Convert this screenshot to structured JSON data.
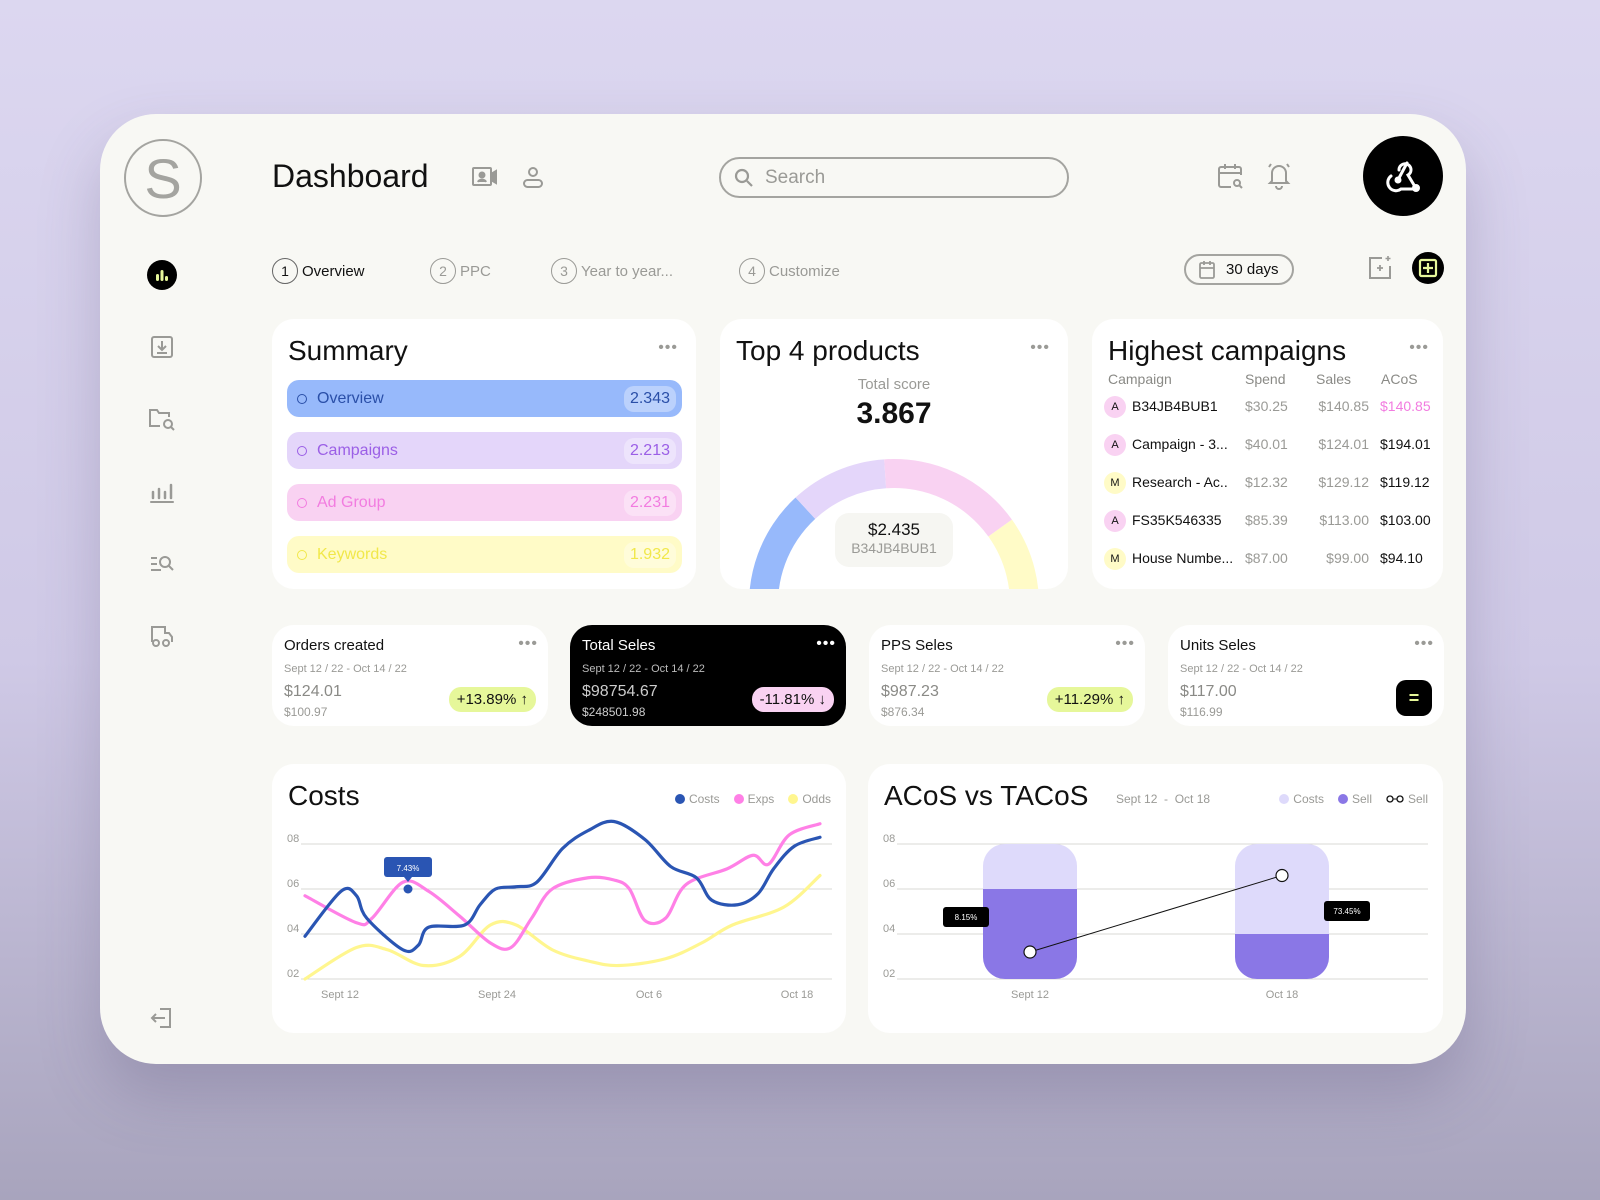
{
  "header": {
    "logo_letter": "S",
    "title": "Dashboard",
    "search_placeholder": "Search"
  },
  "tabs": [
    {
      "num": "1",
      "label": "Overview",
      "active": true
    },
    {
      "num": "2",
      "label": "PPC",
      "active": false
    },
    {
      "num": "3",
      "label": "Year to year...",
      "active": false
    },
    {
      "num": "4",
      "label": "Customize",
      "active": false
    }
  ],
  "date_range_button": "30 days",
  "summary": {
    "title": "Summary",
    "rows": [
      {
        "label": "Overview",
        "value": "2.343"
      },
      {
        "label": "Campaigns",
        "value": "2.213"
      },
      {
        "label": "Ad Group",
        "value": "2.231"
      },
      {
        "label": "Keywords",
        "value": "1.932"
      }
    ]
  },
  "top_products": {
    "title": "Top 4 products",
    "score_label": "Total score",
    "score_value": "3.867",
    "center_value": "$2.435",
    "center_label": "B34JB4BUB1",
    "segments": [
      {
        "share": 0.28,
        "color": "#97b9fb"
      },
      {
        "share": 0.2,
        "color": "#e4d6fa"
      },
      {
        "share": 0.3,
        "color": "#f9d2f2"
      },
      {
        "share": 0.22,
        "color": "#fffbc7"
      }
    ]
  },
  "campaigns": {
    "title": "Highest campaigns",
    "columns": [
      "Campaign",
      "Spend",
      "Sales",
      "ACoS"
    ],
    "rows": [
      {
        "badge": "A",
        "name": "B34JB4BUB1",
        "spend": "$30.25",
        "sales": "$140.85",
        "acos": "$140.85",
        "highlight": true
      },
      {
        "badge": "A",
        "name": "Campaign - 3...",
        "spend": "$40.01",
        "sales": "$124.01",
        "acos": "$194.01",
        "highlight": false
      },
      {
        "badge": "M",
        "name": "Research - Ac..",
        "spend": "$12.32",
        "sales": "$129.12",
        "acos": "$119.12",
        "highlight": false
      },
      {
        "badge": "A",
        "name": "FS35K546335",
        "spend": "$85.39",
        "sales": "$113.00",
        "acos": "$103.00",
        "highlight": false
      },
      {
        "badge": "M",
        "name": "House Numbe...",
        "spend": "$87.00",
        "sales": "$99.00",
        "acos": "$94.10",
        "highlight": false
      }
    ]
  },
  "stats": [
    {
      "title": "Orders created",
      "date": "Sept 12 / 22 - Oct 14 / 22",
      "value": "$124.01",
      "prev": "$100.97",
      "change": "+13.89% ↑"
    },
    {
      "title": "Total Seles",
      "date": "Sept 12 / 22 - Oct 14 / 22",
      "value": "$98754.67",
      "prev": "$248501.98",
      "change": "-11.81% ↓"
    },
    {
      "title": "PPS Seles",
      "date": "Sept 12 / 22 - Oct 14 / 22",
      "value": "$987.23",
      "prev": "$876.34",
      "change": "+11.29% ↑"
    },
    {
      "title": "Units Seles",
      "date": "Sept 12 / 22 - Oct 14 / 22",
      "value": "$117.00",
      "prev": "$116.99",
      "change": "="
    }
  ],
  "chart_data": [
    {
      "type": "line",
      "title": "Costs",
      "x": [
        "Sept 12",
        "Sept 24",
        "Oct 6",
        "Oct 18"
      ],
      "xlim": [
        0,
        1
      ],
      "ylim": [
        2,
        9
      ],
      "yticks": [
        "02",
        "04",
        "06",
        "08"
      ],
      "grid": true,
      "legend": "top-right",
      "tooltip": {
        "series": "Costs",
        "x": 0.2,
        "y": 6.0,
        "label": "7.43%"
      },
      "series": [
        {
          "name": "Costs",
          "color": "#2a55b3",
          "points": [
            [
              0,
              3.9
            ],
            [
              0.07,
              5.9
            ],
            [
              0.1,
              5.7
            ],
            [
              0.12,
              4.7
            ],
            [
              0.19,
              3.3
            ],
            [
              0.22,
              3.5
            ],
            [
              0.24,
              4.3
            ],
            [
              0.31,
              4.4
            ],
            [
              0.34,
              5.3
            ],
            [
              0.37,
              6.0
            ],
            [
              0.41,
              6.1
            ],
            [
              0.45,
              6.3
            ],
            [
              0.5,
              7.8
            ],
            [
              0.55,
              8.6
            ],
            [
              0.6,
              9.0
            ],
            [
              0.66,
              8.2
            ],
            [
              0.71,
              7.0
            ],
            [
              0.76,
              6.5
            ],
            [
              0.79,
              5.5
            ],
            [
              0.84,
              5.3
            ],
            [
              0.88,
              5.8
            ],
            [
              0.91,
              6.9
            ],
            [
              0.95,
              7.9
            ],
            [
              1.0,
              8.3
            ]
          ]
        },
        {
          "name": "Exps",
          "color": "#ff80e6",
          "points": [
            [
              0,
              5.7
            ],
            [
              0.1,
              4.5
            ],
            [
              0.13,
              4.7
            ],
            [
              0.19,
              6.3
            ],
            [
              0.24,
              5.9
            ],
            [
              0.3,
              4.8
            ],
            [
              0.36,
              3.6
            ],
            [
              0.4,
              3.4
            ],
            [
              0.44,
              4.7
            ],
            [
              0.48,
              6.0
            ],
            [
              0.55,
              6.5
            ],
            [
              0.6,
              6.4
            ],
            [
              0.63,
              6.0
            ],
            [
              0.66,
              4.6
            ],
            [
              0.7,
              4.7
            ],
            [
              0.74,
              6.2
            ],
            [
              0.82,
              6.9
            ],
            [
              0.87,
              7.5
            ],
            [
              0.9,
              7.1
            ],
            [
              0.94,
              8.4
            ],
            [
              1.0,
              8.9
            ]
          ]
        },
        {
          "name": "Odds",
          "color": "#fff68f",
          "points": [
            [
              0,
              2.0
            ],
            [
              0.1,
              3.4
            ],
            [
              0.16,
              3.3
            ],
            [
              0.23,
              2.6
            ],
            [
              0.3,
              3.0
            ],
            [
              0.36,
              4.4
            ],
            [
              0.41,
              4.4
            ],
            [
              0.48,
              3.3
            ],
            [
              0.55,
              2.8
            ],
            [
              0.61,
              2.6
            ],
            [
              0.7,
              2.9
            ],
            [
              0.77,
              3.6
            ],
            [
              0.83,
              4.4
            ],
            [
              0.93,
              5.2
            ],
            [
              1.0,
              6.6
            ]
          ]
        }
      ]
    },
    {
      "type": "bar",
      "title": "ACoS vs TACoS",
      "subtitle": "Sept 12  -  Oct 18",
      "categories": [
        "Sept 12",
        "Oct 18"
      ],
      "ylim": [
        2,
        8
      ],
      "yticks": [
        "02",
        "04",
        "06",
        "08"
      ],
      "grid": true,
      "legend": "top-right",
      "series": [
        {
          "name": "Costs",
          "color": "#dedafb",
          "values": [
            8,
            8
          ]
        },
        {
          "name": "Sell",
          "color": "#8a77e6",
          "values": [
            6,
            4
          ]
        },
        {
          "name": "Sell",
          "type": "line",
          "color": "#111111",
          "values": [
            3.2,
            6.6
          ]
        }
      ],
      "annotations": [
        "8.15%",
        "73.45%"
      ]
    }
  ]
}
